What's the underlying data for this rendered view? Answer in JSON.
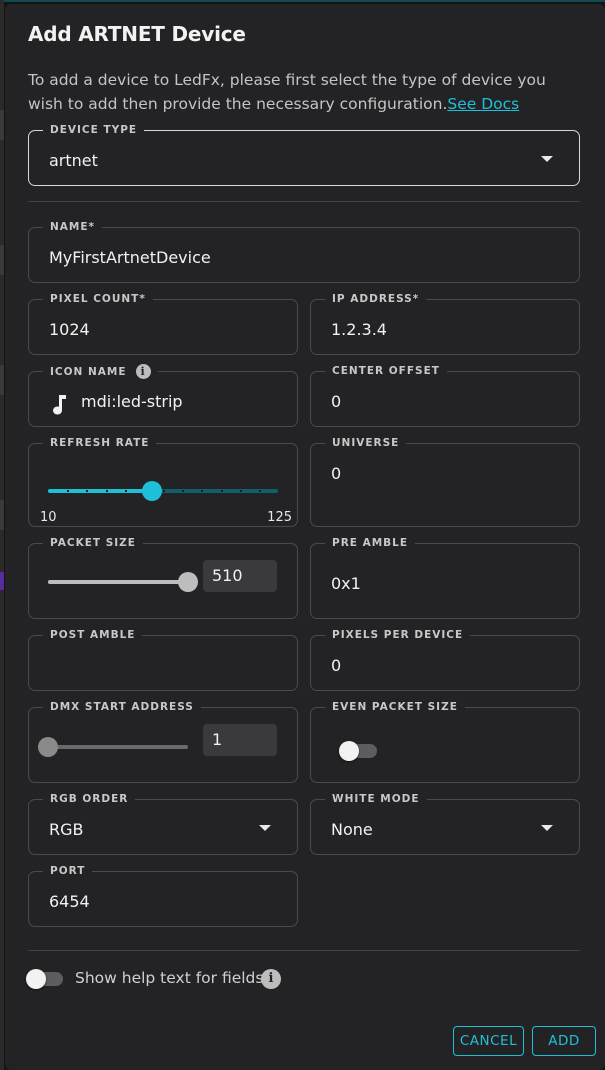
{
  "dialog": {
    "title": "Add ARTNET Device",
    "description": "To add a device to LedFx, please first select the type of device you wish to add then provide the necessary configuration.",
    "docs_link": "See Docs"
  },
  "fields": {
    "device_type": {
      "label": "DEVICE TYPE",
      "value": "artnet"
    },
    "name": {
      "label": "NAME*",
      "value": "MyFirstArtnetDevice"
    },
    "pixel_count": {
      "label": "PIXEL COUNT*",
      "value": "1024"
    },
    "ip_address": {
      "label": "IP ADDRESS*",
      "value": "1.2.3.4"
    },
    "icon_name": {
      "label": "ICON NAME",
      "value": "mdi:led-strip",
      "icon": "music-note-icon"
    },
    "center_offset": {
      "label": "CENTER OFFSET",
      "value": "0"
    },
    "refresh_rate": {
      "label": "REFRESH RATE",
      "min": "10",
      "max": "125",
      "level": 0.45
    },
    "universe": {
      "label": "UNIVERSE",
      "value": "0"
    },
    "packet_size": {
      "label": "PACKET SIZE",
      "value": "510",
      "level": 1.0
    },
    "pre_amble": {
      "label": "PRE AMBLE",
      "value": "0x1"
    },
    "post_amble": {
      "label": "POST AMBLE",
      "value": ""
    },
    "pixels_per_device": {
      "label": "PIXELS PER DEVICE",
      "value": "0"
    },
    "dmx_start_address": {
      "label": "DMX START ADDRESS",
      "value": "1",
      "level": 0.0
    },
    "even_packet_size": {
      "label": "EVEN PACKET SIZE",
      "checked": false
    },
    "rgb_order": {
      "label": "RGB ORDER",
      "value": "RGB"
    },
    "white_mode": {
      "label": "WHITE MODE",
      "value": "None"
    },
    "port": {
      "label": "PORT",
      "value": "6454"
    }
  },
  "help_toggle": {
    "label": "Show help text for fields",
    "checked": false
  },
  "buttons": {
    "cancel": "CANCEL",
    "add": "ADD"
  },
  "colors": {
    "accent": "#1ec0d8",
    "surface": "#232325",
    "border": "#4a4a4d"
  }
}
